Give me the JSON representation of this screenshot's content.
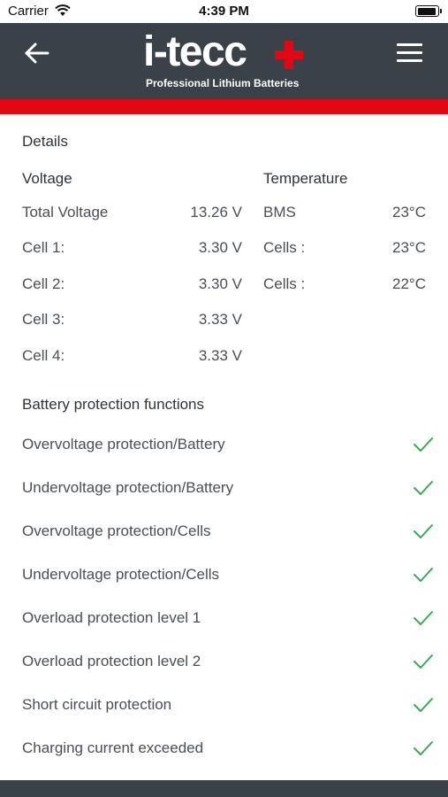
{
  "status_bar": {
    "carrier": "Carrier",
    "time": "4:39 PM"
  },
  "header": {
    "logo_text": "i-tecc",
    "tagline": "Professional Lithium Batteries",
    "icons": [
      "back-arrow-icon",
      "hamburger-menu-icon",
      "plus-icon"
    ]
  },
  "colors": {
    "header": "#3a4148",
    "accent": "#e30613",
    "check": "#3aa856"
  },
  "details": {
    "title": "Details",
    "voltage": {
      "heading": "Voltage",
      "rows": [
        {
          "label": "Total Voltage",
          "value": "13.26 V"
        },
        {
          "label": "Cell 1:",
          "value": "3.30 V"
        },
        {
          "label": "Cell 2:",
          "value": "3.30 V"
        },
        {
          "label": "Cell 3:",
          "value": "3.33 V"
        },
        {
          "label": "Cell 4:",
          "value": "3.33 V"
        }
      ]
    },
    "temperature": {
      "heading": "Temperature",
      "rows": [
        {
          "label": "BMS",
          "value": "23°C"
        },
        {
          "label": "Cells :",
          "value": "23°C"
        },
        {
          "label": "Cells :",
          "value": "22°C"
        }
      ]
    }
  },
  "protection": {
    "title": "Battery protection functions",
    "items": [
      {
        "label": "Overvoltage protection/Battery",
        "status": "ok"
      },
      {
        "label": "Undervoltage protection/Battery",
        "status": "ok"
      },
      {
        "label": "Overvoltage protection/Cells",
        "status": "ok"
      },
      {
        "label": "Undervoltage protection/Cells",
        "status": "ok"
      },
      {
        "label": "Overload protection level 1",
        "status": "ok"
      },
      {
        "label": "Overload protection level 2",
        "status": "ok"
      },
      {
        "label": "Short circuit protection",
        "status": "ok"
      },
      {
        "label": "Charging current exceeded",
        "status": "ok"
      }
    ]
  }
}
